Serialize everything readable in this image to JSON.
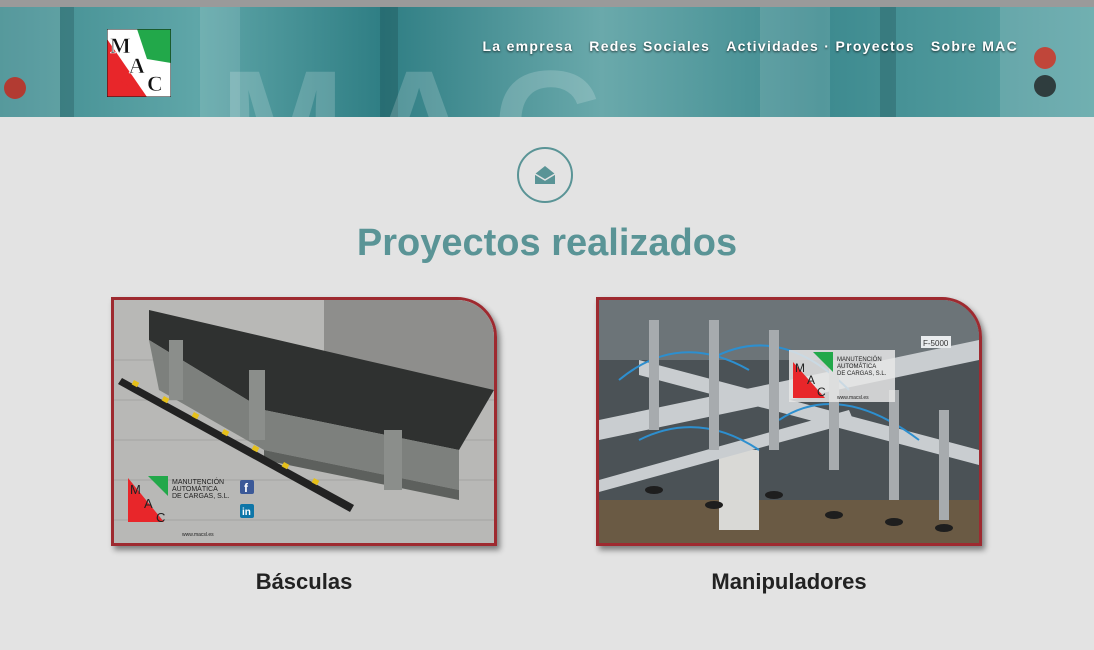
{
  "header": {
    "logo_letters": [
      "M",
      "A",
      "C"
    ],
    "nav": [
      {
        "label": "La empresa"
      },
      {
        "label": "Redes Sociales"
      },
      {
        "label": "Actividades · Proyectos"
      },
      {
        "label": "Sobre MAC"
      }
    ]
  },
  "section": {
    "icon": "envelope-open-icon",
    "title": "Proyectos realizados"
  },
  "projects": [
    {
      "caption": "Básculas",
      "image_overlay": {
        "company_line1": "MANUTENCIÓN",
        "company_line2": "AUTOMÁTICA",
        "company_line3": "DE CARGAS, S.L.",
        "web": "www.macsl.es",
        "social_icons": [
          "facebook-icon",
          "linkedin-icon"
        ]
      }
    },
    {
      "caption": "Manipuladores",
      "image_overlay": {
        "company_line1": "MANUTENCIÓN",
        "company_line2": "AUTOMÁTICA",
        "company_line3": "DE CARGAS, S.L.",
        "web": "www.macsl.es",
        "sign_text": "F-5000"
      }
    }
  ],
  "colors": {
    "accent": "#5a9496",
    "card_border": "#9e2a30",
    "logo_red": "#e8262a",
    "logo_green": "#22a84a",
    "background": "#e3e3e3"
  }
}
